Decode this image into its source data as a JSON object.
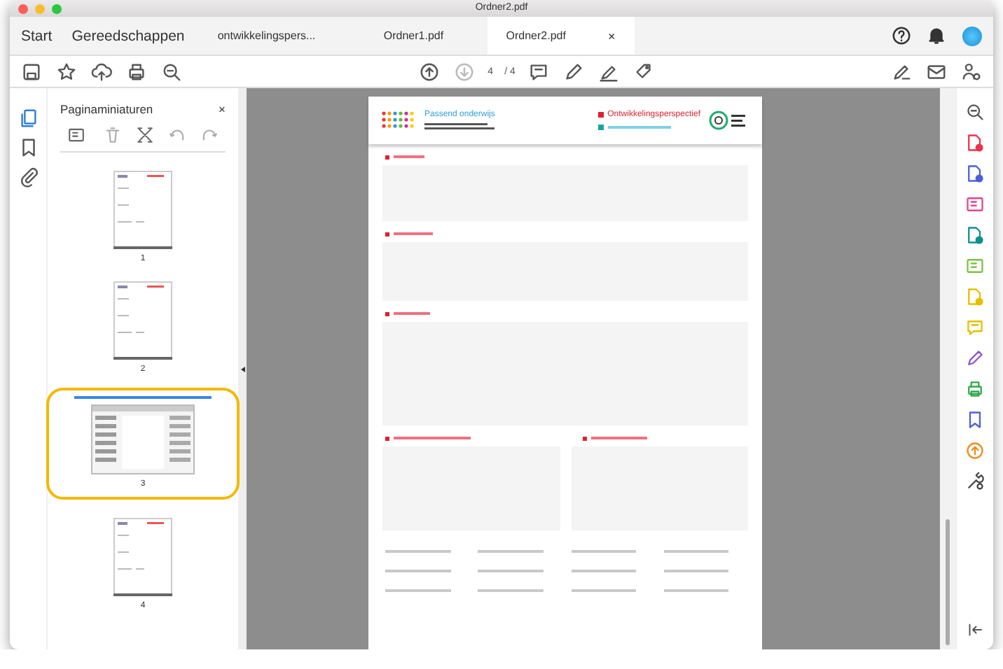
{
  "window": {
    "title": "Ordner2.pdf"
  },
  "tabs": [
    {
      "label": "Start",
      "kind": "menu",
      "selected": false
    },
    {
      "label": "Gereedschappen",
      "kind": "menu",
      "selected": false
    },
    {
      "label": "ontwikkelingspers...",
      "kind": "document",
      "selected": false
    },
    {
      "label": "Ordner1.pdf",
      "kind": "document",
      "selected": false
    },
    {
      "label": "Ordner2.pdf",
      "kind": "document",
      "selected": true,
      "close": "×"
    }
  ],
  "toolbar": {
    "page": "4",
    "page_count": "/ 4"
  },
  "panel": {
    "title": "Paginaminiaturen",
    "close": "×",
    "thumbnails": [
      {
        "label": "1",
        "kind": "portrait",
        "selected": false
      },
      {
        "label": "2",
        "kind": "portrait",
        "selected": false
      },
      {
        "label": "3",
        "kind": "landscape",
        "selected": true
      },
      {
        "label": "4",
        "kind": "portrait",
        "selected": false
      }
    ]
  },
  "document": {
    "brand": "Passend onderwijs",
    "legend": "Ontwikkelingsperspectief"
  }
}
